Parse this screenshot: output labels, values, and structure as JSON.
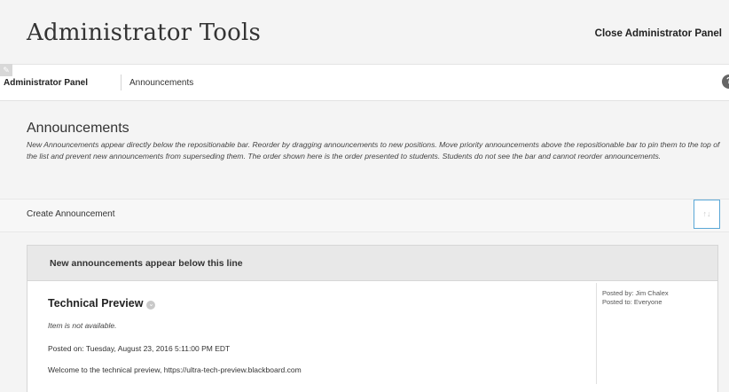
{
  "header": {
    "title": "Administrator Tools",
    "close_label": "Close Administrator Panel"
  },
  "breadcrumb": {
    "items": [
      "Administrator Panel",
      "Announcements"
    ]
  },
  "icons": {
    "edit": "pencil-icon",
    "help": "help-icon",
    "reorder": "reorder-arrows-icon",
    "status": "unavailable-status-icon"
  },
  "section": {
    "heading": "Announcements",
    "description": "New Announcements appear directly below the repositionable bar. Reorder by dragging announcements to new positions. Move priority announcements above the repositionable bar to pin them to the top of the list and prevent new announcements from superseding them. The order shown here is the order presented to students. Students do not see the bar and cannot reorder announcements."
  },
  "actions": {
    "create_label": "Create Announcement"
  },
  "list": {
    "divider_label": "New announcements appear below this line",
    "items": [
      {
        "title": "Technical Preview",
        "availability": "Item is not available.",
        "posted_on": "Posted on: Tuesday, August 23, 2016 5:11:00 PM EDT",
        "body": "Welcome to the technical preview, https://ultra-tech-preview.blackboard.com",
        "posted_by": "Posted by: Jim Chalex",
        "posted_to": "Posted to: Everyone"
      }
    ]
  },
  "colors": {
    "page_bg": "#f4f4f4",
    "focus_border": "#5aa7d6",
    "divider_bg": "#e8e8e8"
  }
}
